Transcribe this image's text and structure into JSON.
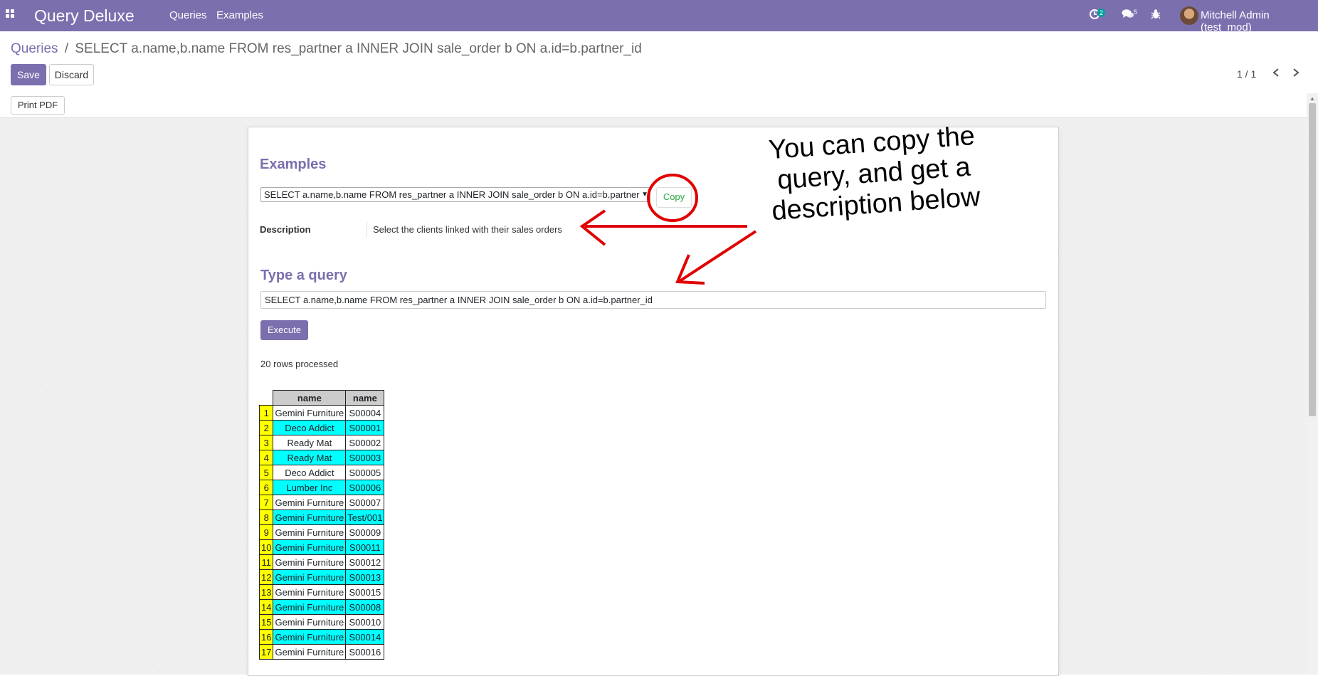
{
  "navbar": {
    "brand": "Query Deluxe",
    "menu": [
      "Queries",
      "Examples"
    ],
    "activity_count": "2",
    "messages_count": "5",
    "user": "Mitchell Admin (test_mod)"
  },
  "breadcrumb": {
    "parent": "Queries",
    "separator": "/",
    "current": "SELECT a.name,b.name FROM res_partner a INNER JOIN sale_order b ON a.id=b.partner_id"
  },
  "buttons": {
    "save": "Save",
    "discard": "Discard",
    "print_pdf": "Print PDF",
    "copy": "Copy",
    "execute": "Execute"
  },
  "pager": {
    "text": "1 / 1"
  },
  "form": {
    "examples_title": "Examples",
    "example_selected": "SELECT a.name,b.name FROM res_partner a INNER JOIN sale_order b ON a.id=b.partner",
    "description_label": "Description",
    "description_value": "Select the clients linked with their sales orders",
    "type_query_title": "Type a query",
    "query_value": "SELECT a.name,b.name FROM res_partner a INNER JOIN sale_order b ON a.id=b.partner_id",
    "rows_processed": "20 rows processed"
  },
  "result": {
    "headers": [
      "name",
      "name"
    ],
    "rows": [
      [
        "1",
        "Gemini Furniture",
        "S00004"
      ],
      [
        "2",
        "Deco Addict",
        "S00001"
      ],
      [
        "3",
        "Ready Mat",
        "S00002"
      ],
      [
        "4",
        "Ready Mat",
        "S00003"
      ],
      [
        "5",
        "Deco Addict",
        "S00005"
      ],
      [
        "6",
        "Lumber Inc",
        "S00006"
      ],
      [
        "7",
        "Gemini Furniture",
        "S00007"
      ],
      [
        "8",
        "Gemini Furniture",
        "Test/001"
      ],
      [
        "9",
        "Gemini Furniture",
        "S00009"
      ],
      [
        "10",
        "Gemini Furniture",
        "S00011"
      ],
      [
        "11",
        "Gemini Furniture",
        "S00012"
      ],
      [
        "12",
        "Gemini Furniture",
        "S00013"
      ],
      [
        "13",
        "Gemini Furniture",
        "S00015"
      ],
      [
        "14",
        "Gemini Furniture",
        "S00008"
      ],
      [
        "15",
        "Gemini Furniture",
        "S00010"
      ],
      [
        "16",
        "Gemini Furniture",
        "S00014"
      ],
      [
        "17",
        "Gemini Furniture",
        "S00016"
      ]
    ]
  },
  "annotation": {
    "line1": "You can copy the",
    "line2": "query, and get a",
    "line3": "description below"
  },
  "colors": {
    "brand": "#7c6fae",
    "row_highlight": "#00ffff",
    "index_highlight": "#ffff00",
    "annotation": "#e00000"
  }
}
